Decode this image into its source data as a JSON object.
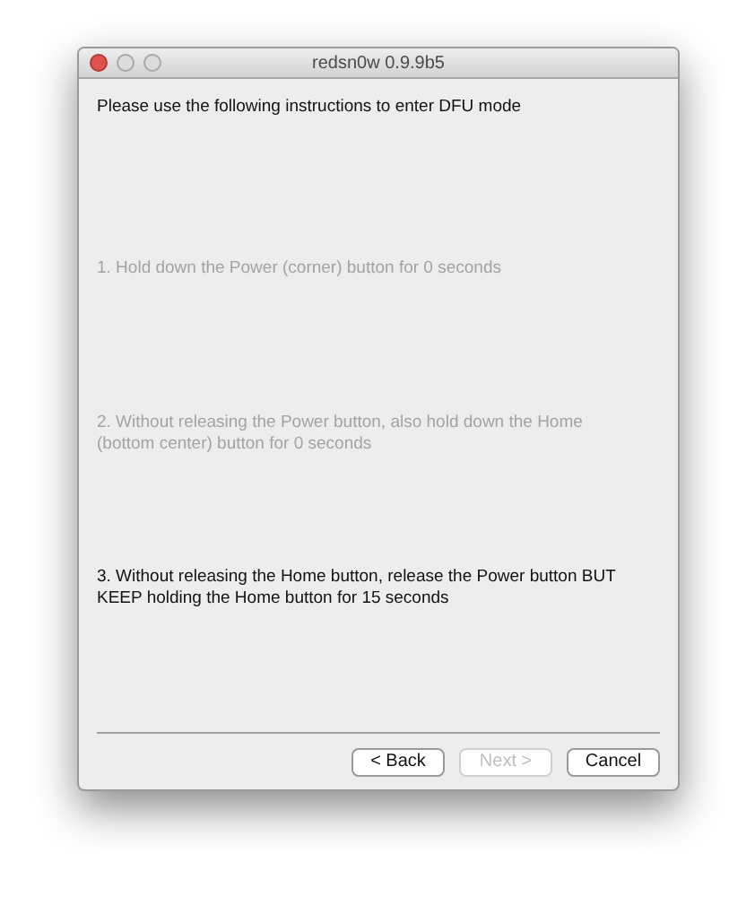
{
  "window": {
    "title": "redsn0w 0.9.9b5"
  },
  "heading": "Please use the following instructions to enter DFU mode",
  "steps": [
    {
      "text": "1. Hold down the Power (corner) button for 0 seconds",
      "active": false
    },
    {
      "text": "2. Without releasing the Power button, also hold down the Home (bottom center) button for 0 seconds",
      "active": false
    },
    {
      "text": "3. Without releasing the Home button, release the Power button BUT KEEP holding the Home button for 15 seconds",
      "active": true
    }
  ],
  "buttons": [
    {
      "label": "< Back",
      "disabled": false
    },
    {
      "label": "Next >",
      "disabled": true
    },
    {
      "label": "Cancel",
      "disabled": false
    }
  ]
}
